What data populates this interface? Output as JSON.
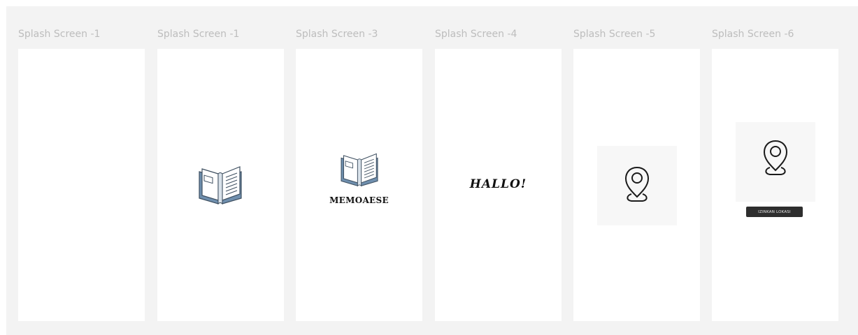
{
  "frames": [
    {
      "label": "Splash Screen -1"
    },
    {
      "label": "Splash Screen -1",
      "icon": "open-book-icon"
    },
    {
      "label": "Splash Screen -3",
      "icon": "open-book-icon",
      "wordmark": "MEMOAESE"
    },
    {
      "label": "Splash Screen -4",
      "wordmark": "HALLO!"
    },
    {
      "label": "Splash Screen -5",
      "icon": "location-pin-icon"
    },
    {
      "label": "Splash Screen -6",
      "icon": "location-pin-icon",
      "button_label": "IZINKAN LOKASI"
    }
  ],
  "colors": {
    "canvas": "#f3f3f3",
    "frame": "#ffffff",
    "label": "#bdbdbd",
    "book_blue": "#6f8fae",
    "button": "#2e2e2e"
  }
}
